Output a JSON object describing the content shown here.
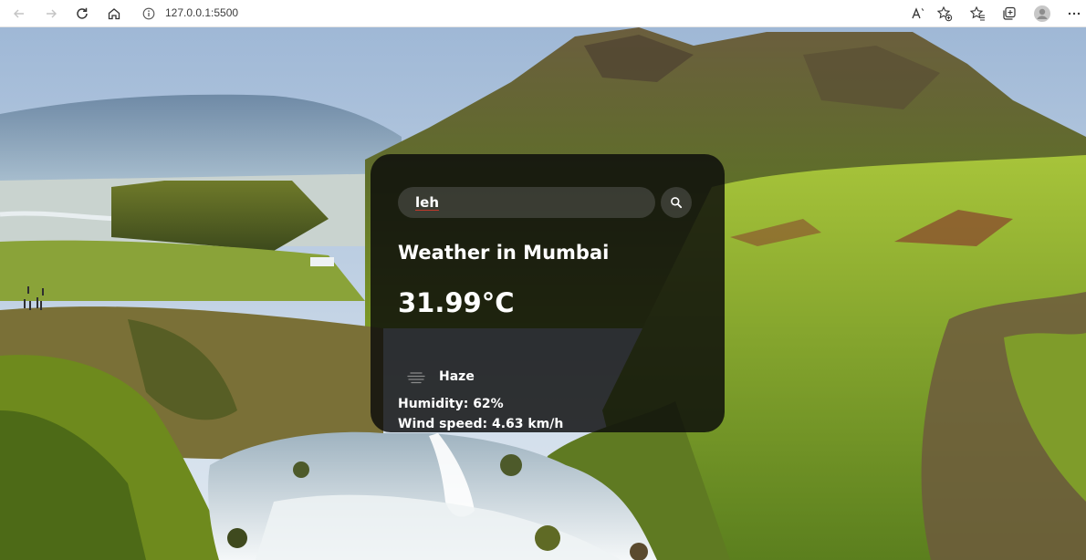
{
  "browser": {
    "url": "127.0.0.1:5500"
  },
  "weather": {
    "search": {
      "value": "leh"
    },
    "city_title": "Weather in Mumbai",
    "temperature": "31.99°C",
    "description": "Haze",
    "humidity_label": "Humidity:",
    "humidity_value": "62%",
    "wind_label": "Wind speed:",
    "wind_value": "4.63 km/h"
  },
  "icons": {
    "back": "back-arrow-icon",
    "forward": "forward-arrow-icon",
    "refresh": "refresh-icon",
    "home": "home-icon",
    "site_info": "info-icon",
    "read_aloud": "read-aloud-icon",
    "favorite_add": "add-favorite-icon",
    "favorites": "favorites-icon",
    "collections": "collections-icon",
    "profile": "avatar",
    "menu": "more-icon",
    "search": "search-icon",
    "weather": "haze-icon"
  },
  "colors": {
    "card_background": "#0a0a0a",
    "text": "#ffffff",
    "spell_underline": "#c0392b"
  }
}
